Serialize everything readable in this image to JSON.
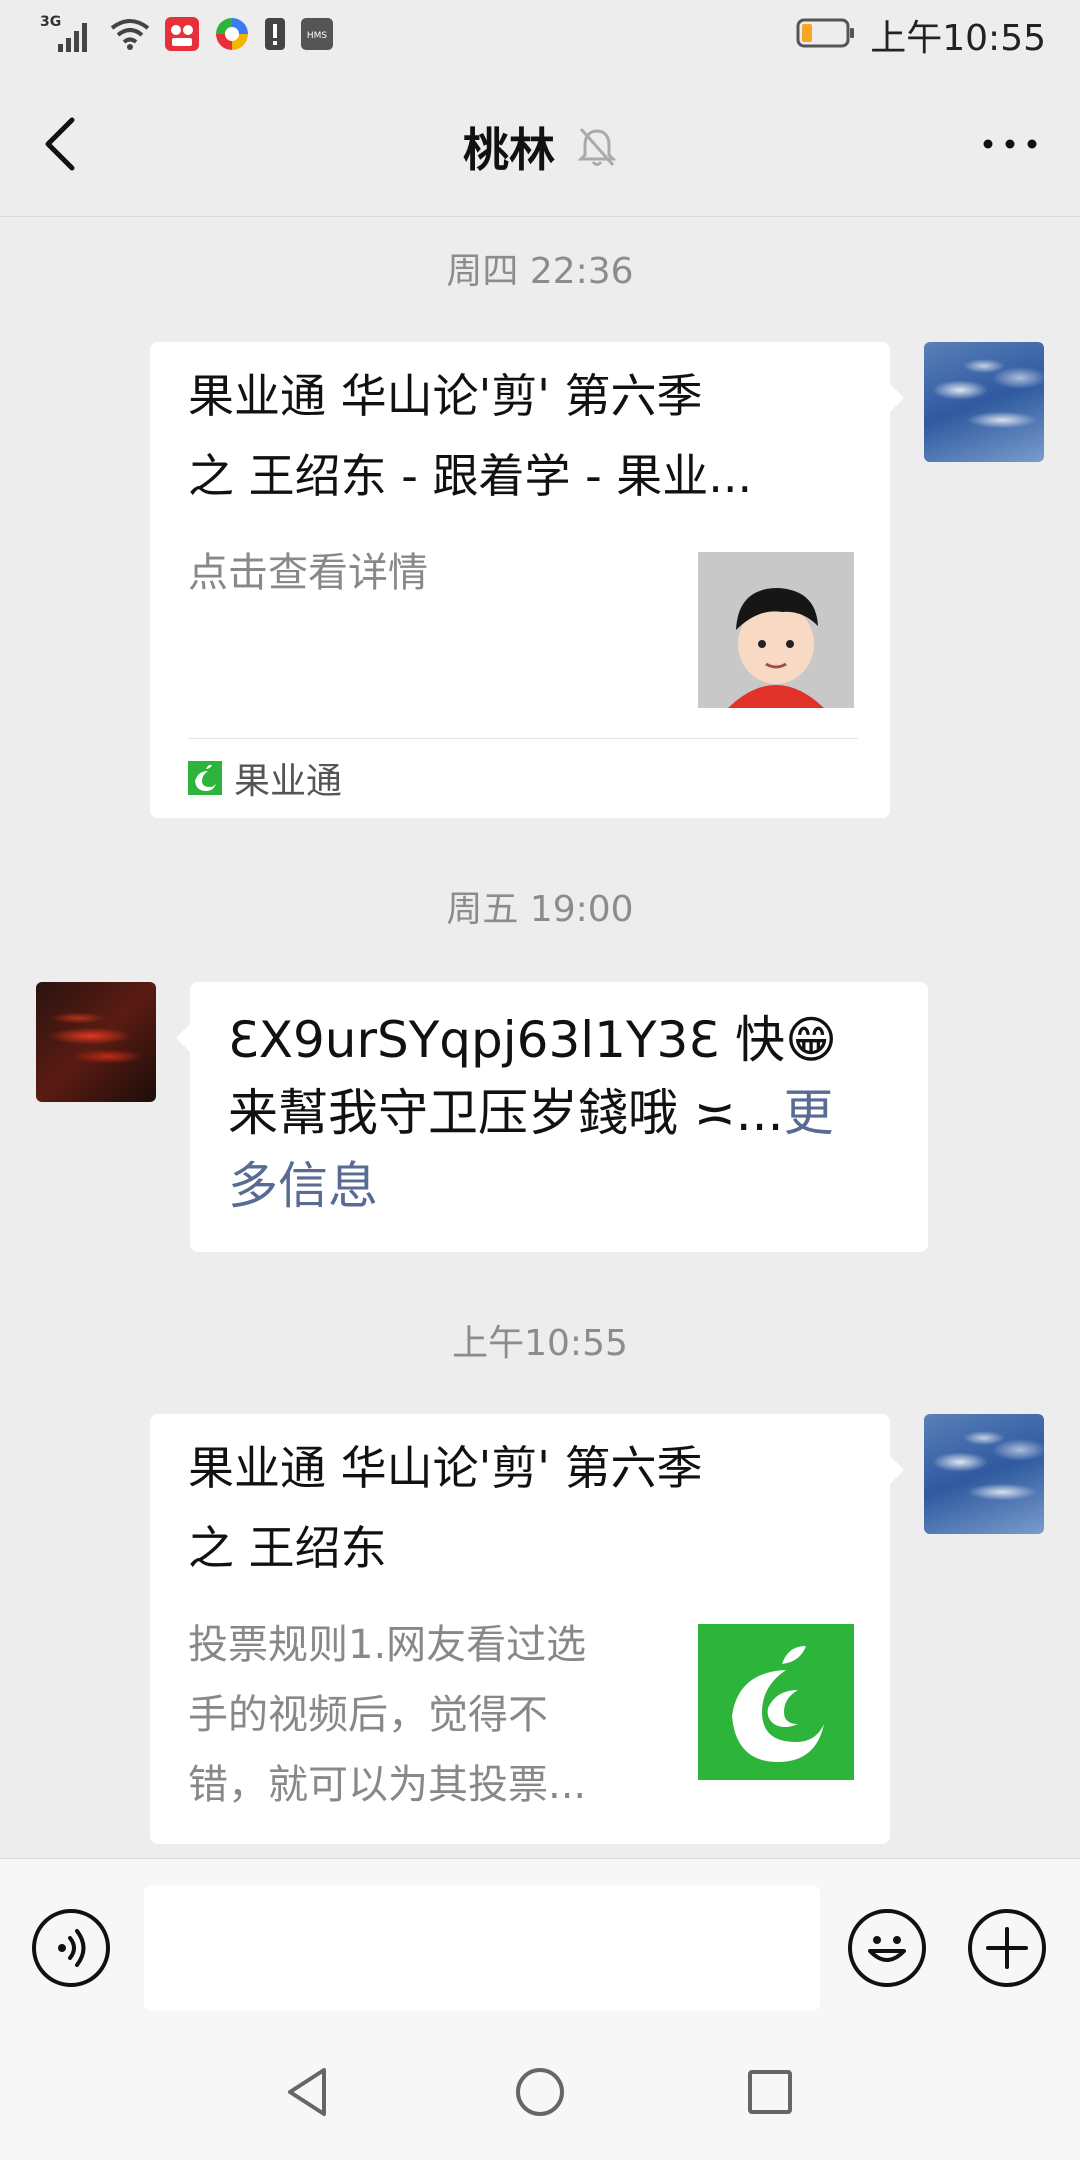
{
  "status_bar": {
    "network": "3G",
    "time": "上午10:55",
    "icons": [
      "signal-icon",
      "wifi-icon",
      "video-app-icon",
      "colorful-app-icon",
      "alert-icon",
      "hms-icon",
      "battery-icon"
    ]
  },
  "nav": {
    "title": "桃林",
    "back_icon": "chevron-left-icon",
    "mute_icon": "bell-off-icon",
    "more_icon": "more-dots-icon"
  },
  "messages": [
    {
      "timestamp": "周四 22:36",
      "type": "card",
      "side": "right",
      "title_line1": "果业通 华山论'剪' 第六季",
      "title_line2": "之 王绍东 - 跟着学 - 果业...",
      "desc_line1": "点击查看详情",
      "source": "果业通"
    },
    {
      "timestamp": "周五 19:00",
      "type": "text",
      "side": "left",
      "line1": "ƐX9urSYqpj63l1Y3Ɛ 快😁",
      "line2": "来幫我守卫压岁錢哦 ≍...",
      "line2_more": "更",
      "line3_more": "多信息"
    },
    {
      "timestamp": "上午10:55",
      "type": "card",
      "side": "right",
      "title_line1": "果业通 华山论'剪' 第六季",
      "title_line2": "之 王绍东",
      "desc_line1": "投票规则1.网友看过选",
      "desc_line2": "手的视频后，觉得不",
      "desc_line3": "错，就可以为其投票..."
    }
  ],
  "input_bar": {
    "placeholder": "",
    "voice_icon": "voice-icon",
    "emoji_icon": "emoji-icon",
    "add_icon": "plus-icon"
  },
  "colors": {
    "background": "#ededed",
    "brand_green": "#2cb53a",
    "link_blue": "#576b95"
  }
}
